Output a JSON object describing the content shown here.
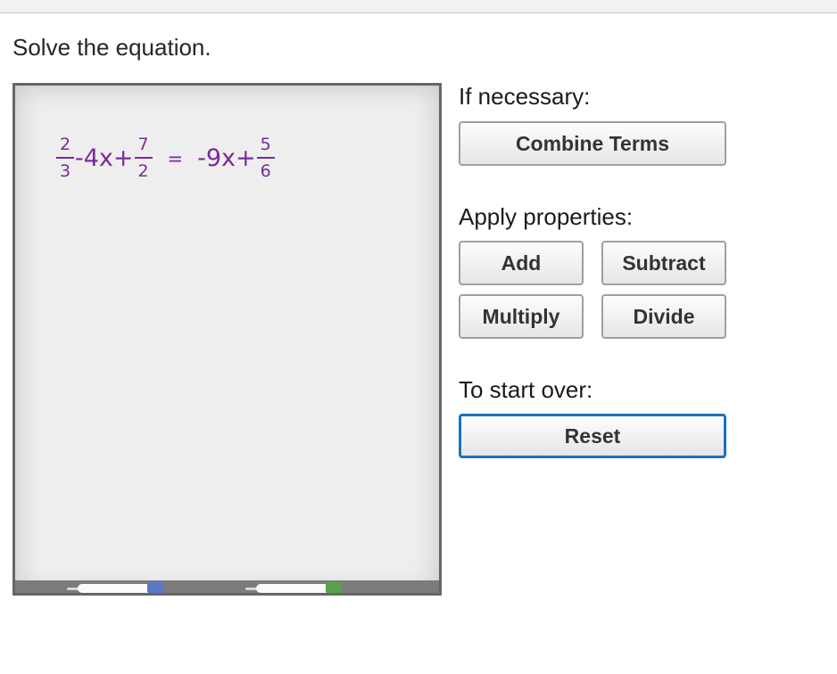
{
  "prompt": "Solve the equation.",
  "equation": {
    "lhs_frac1": {
      "num": "2",
      "den": "3"
    },
    "lhs_mid": "-4x+",
    "lhs_frac2": {
      "num": "7",
      "den": "2"
    },
    "equals": "=",
    "rhs_mid": "-9x+",
    "rhs_frac": {
      "num": "5",
      "den": "6"
    },
    "color": "#7b2a9a"
  },
  "labels": {
    "if_necessary": "If necessary:",
    "apply_properties": "Apply properties:",
    "start_over": "To start over:"
  },
  "buttons": {
    "combine_terms": "Combine Terms",
    "add": "Add",
    "subtract": "Subtract",
    "multiply": "Multiply",
    "divide": "Divide",
    "reset": "Reset"
  },
  "colors": {
    "focus_ring": "#1c6fc4",
    "marker_blue": "#5a77c8",
    "marker_green": "#5aa14a"
  },
  "icons": [
    "blue-marker-icon",
    "green-marker-icon"
  ]
}
